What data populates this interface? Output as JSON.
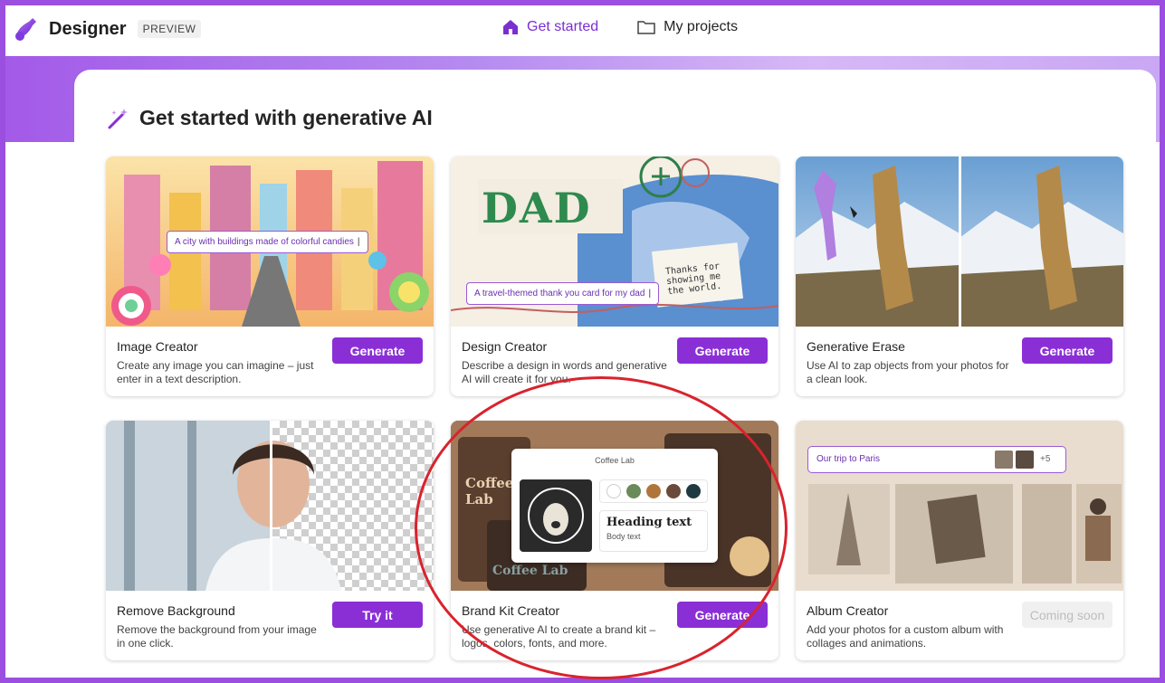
{
  "app": {
    "name": "Designer",
    "badge": "PREVIEW"
  },
  "nav": {
    "get_started": "Get started",
    "my_projects": "My projects"
  },
  "section": {
    "title": "Get started with generative AI"
  },
  "cards": [
    {
      "title": "Image Creator",
      "desc": "Create any image you can imagine – just enter in a text description.",
      "button": "Generate",
      "prompt": "A city with buildings made of colorful candies"
    },
    {
      "title": "Design Creator",
      "desc": "Describe a design in words and generative AI will create it for you.",
      "button": "Generate",
      "prompt": "A travel-themed thank you card for my dad",
      "card_text": "DAD",
      "note": "Thanks for showing me the world."
    },
    {
      "title": "Generative Erase",
      "desc": "Use AI to zap objects from your photos for a clean look.",
      "button": "Generate"
    },
    {
      "title": "Remove Background",
      "desc": "Remove the background from your image in one click.",
      "button": "Try it"
    },
    {
      "title": "Brand Kit Creator",
      "desc": "Use generative AI to create a brand kit – logos, colors, fonts, and more.",
      "button": "Generate",
      "kit_title": "Coffee Lab",
      "heading": "Heading text",
      "body": "Body text",
      "bg_text": "Coffee Lab",
      "swatches": [
        "#ffffff",
        "#6b8a5a",
        "#b0753a",
        "#6a4a3a",
        "#1f3a40"
      ]
    },
    {
      "title": "Album Creator",
      "desc": "Add your photos for a custom album with collages and animations.",
      "button": "Coming soon",
      "prompt": "Our trip to Paris",
      "more": "+5"
    }
  ],
  "colors": {
    "accent": "#8a2fd6",
    "annotation": "#d9232d"
  }
}
